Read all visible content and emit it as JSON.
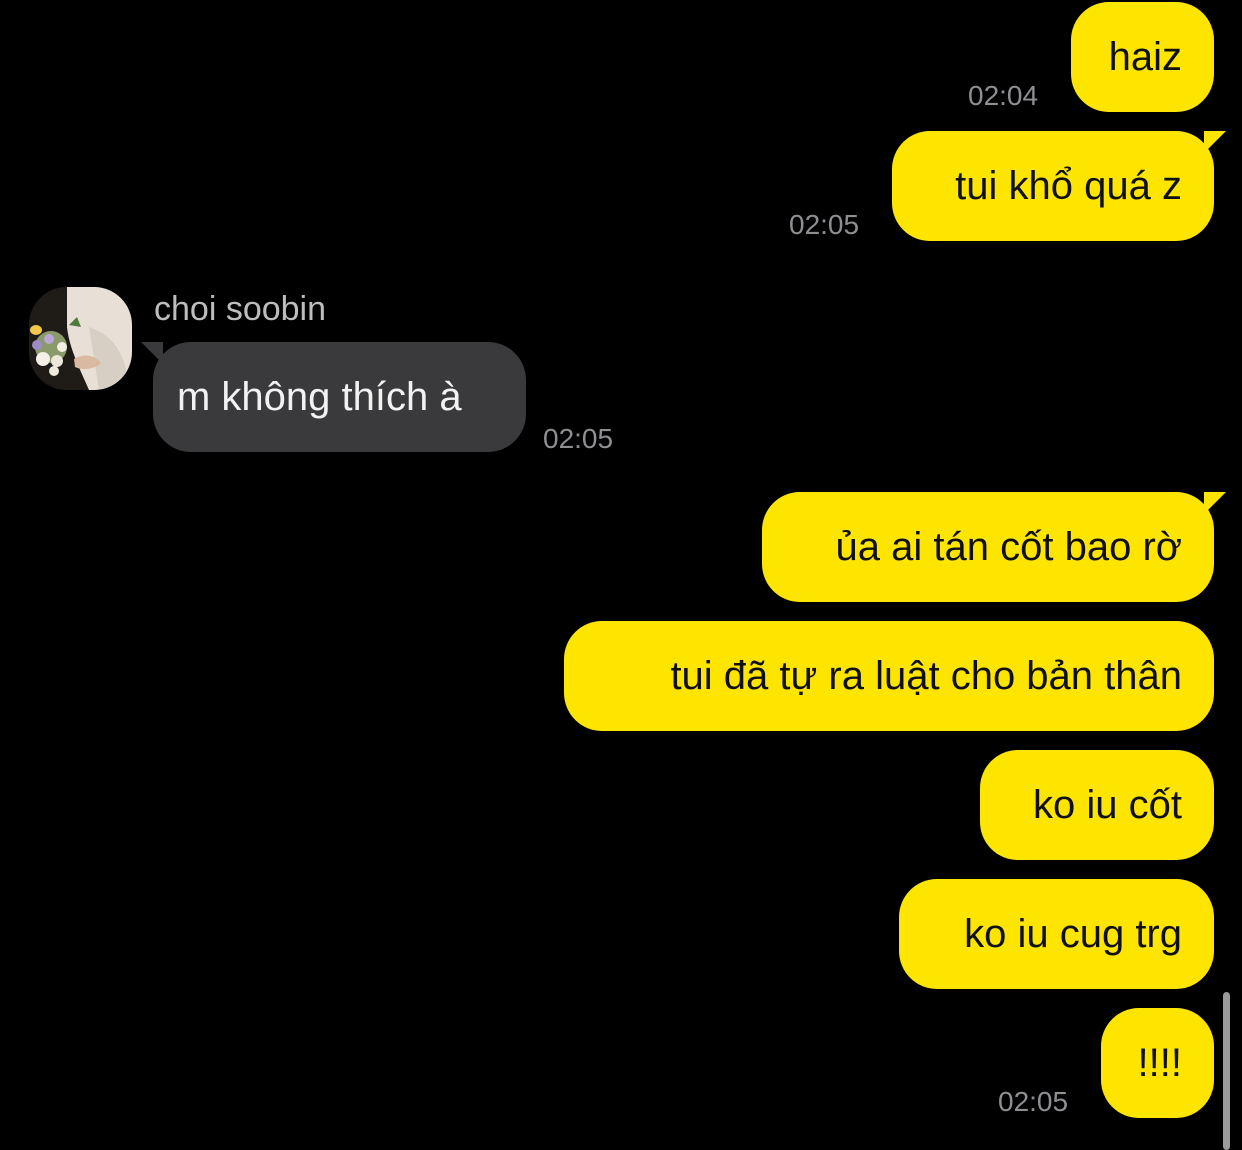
{
  "messages": [
    {
      "side": "mine",
      "text": "haiz",
      "time": "02:04"
    },
    {
      "side": "mine",
      "text": "tui khổ quá z",
      "time": "02:05"
    },
    {
      "side": "theirs",
      "sender": "choi soobin",
      "text": "m không thích à",
      "time": "02:05"
    },
    {
      "side": "mine",
      "text": "ủa ai tán cốt bao rờ"
    },
    {
      "side": "mine",
      "text": "tui đã tự ra luật cho bản thân"
    },
    {
      "side": "mine",
      "text": "ko iu cốt"
    },
    {
      "side": "mine",
      "text": "ko iu cug trg"
    },
    {
      "side": "mine",
      "text": "!!!!",
      "time": "02:05"
    }
  ],
  "colors": {
    "background": "#000000",
    "my_bubble": "#FEE500",
    "their_bubble": "#3A3A3C",
    "timestamp": "#8E8E93"
  },
  "icons": {
    "avatar": "profile-photo-with-flowers"
  }
}
